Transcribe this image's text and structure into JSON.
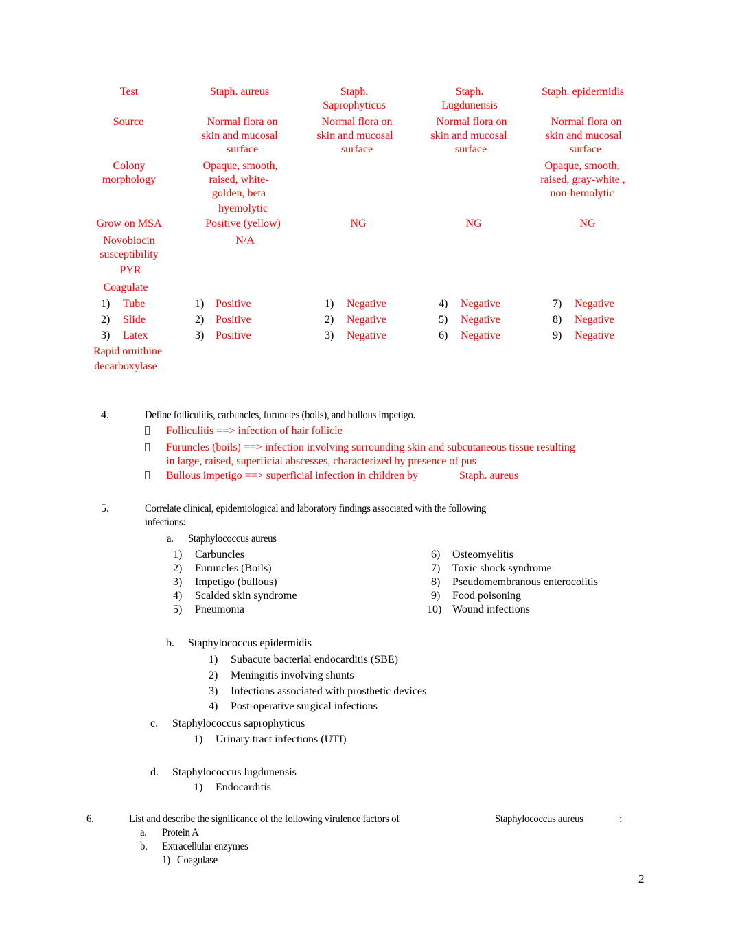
{
  "table": {
    "headers": [
      "Test",
      "Staph. aureus",
      "Staph.\nSaprophyticus",
      "Staph.\nLugdunensis",
      "Staph. epidermidis"
    ],
    "header_lines": {
      "test": "Test",
      "aureus": "Staph. aureus",
      "sapro_1": "Staph.",
      "sapro_2": "Saprophyticus",
      "lugd_1": "Staph.",
      "lugd_2": "Lugdunensis",
      "epi": "Staph. epidermidis"
    },
    "rows": {
      "source": {
        "label": "Source",
        "aureus": [
          "Normal flora on",
          "skin and mucosal",
          "surface"
        ],
        "sapro": [
          "Normal flora on",
          "skin and mucosal",
          "surface"
        ],
        "lugd": [
          "Normal flora on",
          "skin and mucosal",
          "surface"
        ],
        "epi": [
          "Normal flora on",
          "skin and mucosal",
          "surface"
        ]
      },
      "colony": {
        "label": [
          "Colony",
          "morphology"
        ],
        "aureus": [
          "Opaque, smooth,",
          "raised, white-",
          "golden, beta",
          "hyemolytic"
        ],
        "sapro": [],
        "lugd": [],
        "epi": [
          "Opaque, smooth,",
          "raised, gray-white ,",
          "non-hemolytic"
        ]
      },
      "msa": {
        "label": "Grow on MSA",
        "aureus": "Positive (yellow)",
        "sapro": "NG",
        "lugd": "NG",
        "epi": "NG"
      },
      "novobiocin": {
        "label": [
          "Novobiocin",
          "susceptibility"
        ],
        "aureus": "N/A"
      },
      "pyr": {
        "label": "PYR"
      },
      "coagulate": {
        "label": "Coagulate",
        "tests": [
          {
            "num": "1)",
            "name": "Tube"
          },
          {
            "num": "2)",
            "name": "Slide"
          },
          {
            "num": "3)",
            "name": "Latex"
          }
        ],
        "aureus": [
          {
            "num": "1)",
            "val": "Positive"
          },
          {
            "num": "2)",
            "val": "Positive"
          },
          {
            "num": "3)",
            "val": "Positive"
          }
        ],
        "sapro": [
          {
            "num": "1)",
            "val": "Negative"
          },
          {
            "num": "2)",
            "val": "Negative"
          },
          {
            "num": "3)",
            "val": "Negative"
          }
        ],
        "lugd": [
          {
            "num": "4)",
            "val": "Negative"
          },
          {
            "num": "5)",
            "val": "Negative"
          },
          {
            "num": "6)",
            "val": "Negative"
          }
        ],
        "epi": [
          {
            "num": "7)",
            "val": "Negative"
          },
          {
            "num": "8)",
            "val": "Negative"
          },
          {
            "num": "9)",
            "val": "Negative"
          }
        ]
      },
      "ornithine": {
        "label": [
          "Rapid ornithine",
          "decarboxylase"
        ]
      }
    }
  },
  "q4": {
    "num": "4.",
    "question": "Define folliculitis, carbuncles, furuncles (boils), and bullous impetigo.",
    "answers": [
      [
        "Folliculitis ==> infection of hair follicle"
      ],
      [
        "Furuncles (boils) ==> infection involving surrounding skin and subcutaneous tissue resulting",
        "in large, raised, superficial abscesses, characterized by presence of pus"
      ],
      [
        "Bullous impetigo ==> superficial infection in children by",
        "Staph. aureus"
      ]
    ]
  },
  "q5": {
    "num": "5.",
    "question_1": "Correlate clinical, epidemiological and laboratory findings associated with the following",
    "question_2": "infections:",
    "a": {
      "letter": "a.",
      "title": "Staphylococcus aureus",
      "left": [
        {
          "num": "1)",
          "text": "Carbuncles"
        },
        {
          "num": "2)",
          "text": "Furuncles (Boils)"
        },
        {
          "num": "3)",
          "text": "Impetigo (bullous)"
        },
        {
          "num": "4)",
          "text": "Scalded skin syndrome"
        },
        {
          "num": "5)",
          "text": "Pneumonia"
        }
      ],
      "right": [
        {
          "num": "6)",
          "text": "Osteomyelitis"
        },
        {
          "num": "7)",
          "text": "Toxic shock syndrome"
        },
        {
          "num": "8)",
          "text": "Pseudomembranous enterocolitis"
        },
        {
          "num": "9)",
          "text": "Food poisoning"
        },
        {
          "num": "10)",
          "text": "Wound infections"
        }
      ]
    },
    "b": {
      "letter": "b.",
      "title": "Staphylococcus epidermidis",
      "items": [
        {
          "num": "1)",
          "text": "Subacute bacterial endocarditis (SBE)"
        },
        {
          "num": "2)",
          "text": "Meningitis involving shunts"
        },
        {
          "num": "3)",
          "text": "Infections associated with prosthetic devices"
        },
        {
          "num": "4)",
          "text": "Post-operative surgical infections"
        }
      ]
    },
    "c": {
      "letter": "c.",
      "title": "Staphylococcus saprophyticus",
      "items": [
        {
          "num": "1)",
          "text": "Urinary tract infections (UTI)"
        }
      ]
    },
    "d": {
      "letter": "d.",
      "title": "Staphylococcus lugdunensis",
      "items": [
        {
          "num": "1)",
          "text": "Endocarditis"
        }
      ]
    }
  },
  "q6": {
    "num": "6.",
    "question": "List and describe the significance of the following virulence factors of",
    "organism": "Staphylococcus aureus",
    "colon": ":",
    "items": [
      {
        "letter": "a.",
        "text": "Protein A"
      },
      {
        "letter": "b.",
        "text": "Extracellular enzymes"
      }
    ],
    "sub": {
      "num": "1)",
      "text": "Coagulase"
    }
  },
  "page_number": "2",
  "colors": {
    "answer": "#ff0000",
    "text": "#000000"
  }
}
